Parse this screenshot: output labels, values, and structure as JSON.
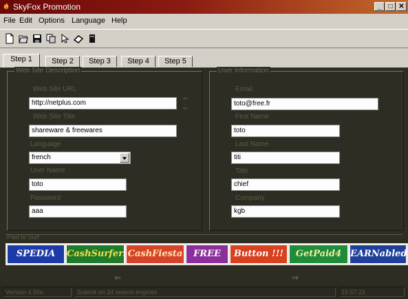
{
  "window": {
    "title": "SkyFox Promotion",
    "controls": [
      "_",
      "□",
      "✕"
    ]
  },
  "menu": [
    {
      "label": "File"
    },
    {
      "label": "Edit"
    },
    {
      "label": "Options"
    },
    {
      "label": "Language"
    },
    {
      "label": "Help"
    }
  ],
  "toolbar": {
    "icons": [
      "new-document-icon",
      "open-icon",
      "save-icon",
      "copy-icon",
      "cursor-icon",
      "eraser-icon",
      "book-icon"
    ]
  },
  "tabs": [
    {
      "label": "Step 1",
      "active": true
    },
    {
      "label": "Step 2",
      "active": false
    },
    {
      "label": "Step 3",
      "active": false
    },
    {
      "label": "Step 4",
      "active": false
    },
    {
      "label": "Step 5",
      "active": false
    }
  ],
  "site_panel": {
    "legend": "Web Site Description",
    "url_label": "Web Site URL",
    "url_value": "http://netplus.com",
    "title_label": "Web Site Title",
    "title_value": "shareware & freewares",
    "language_label": "Language",
    "language_value": "french",
    "username_label": "User Name",
    "username_value": "toto",
    "password_label": "Password",
    "password_value": "aaa"
  },
  "user_panel": {
    "legend": "User Information",
    "email_label": "Email",
    "email_value": "toto@free.fr",
    "firstname_label": "First Name",
    "firstname_value": "toto",
    "lastname_label": "Last Name",
    "lastname_value": "titi",
    "job_label": "Title",
    "job_value": "chief",
    "company_label": "Company",
    "company_value": "kgb"
  },
  "paid_section": {
    "label": "Paid to Surf"
  },
  "banners": [
    {
      "label": "SPEDIA",
      "bg": "#1d3aa8",
      "fg": "#ffffff"
    },
    {
      "label": "CashSurfers",
      "bg": "#1f7a2a",
      "fg": "#f4e04a"
    },
    {
      "label": "CashFiesta",
      "bg": "#d7432a",
      "fg": "#ffe9b0"
    },
    {
      "label": "FREE",
      "bg": "#8c2f9c",
      "fg": "#ffffff"
    },
    {
      "label": "Button !!!",
      "bg": "#d8401f",
      "fg": "#ffffff"
    },
    {
      "label": "GetPaid4",
      "bg": "#1e8c3a",
      "fg": "#f1ef9c"
    },
    {
      "label": "EARNabled",
      "bg": "#1f3f9a",
      "fg": "#ffffff"
    }
  ],
  "nav": {
    "prev": "⇐",
    "next": "⇒"
  },
  "status": {
    "version": "Version 4.55e",
    "message": "Submit on 34 search engines",
    "time": "15:57:21"
  }
}
